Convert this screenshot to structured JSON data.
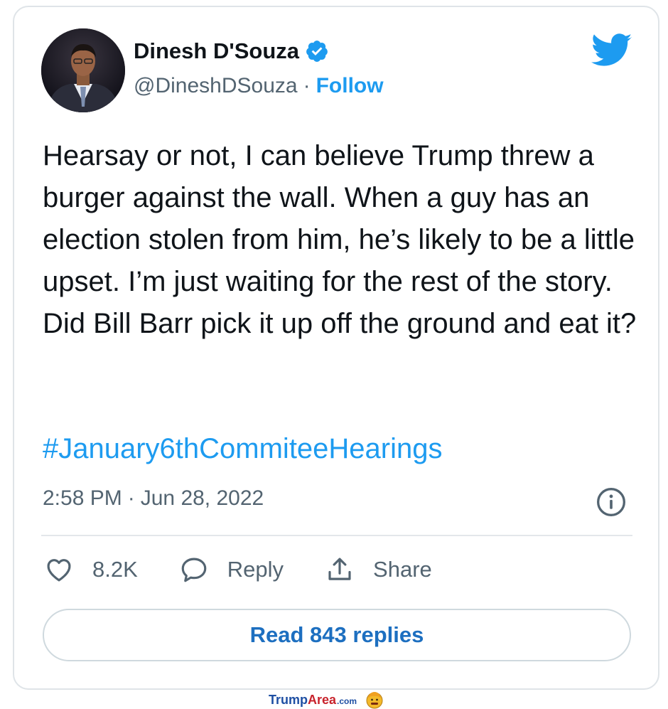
{
  "author": {
    "name": "Dinesh D'Souza",
    "handle": "@DineshDSouza",
    "separator": "·",
    "follow_label": "Follow"
  },
  "tweet": {
    "text": "Hearsay or not, I can believe Trump threw a burger against the wall. When a guy has an election stolen from him, he’s likely to be a little upset. I’m just waiting for the rest of the story. Did Bill Barr pick it up off the ground and eat it?",
    "hashtag": "#January6thCommiteeHearings",
    "time": "2:58 PM",
    "date_separator": "·",
    "date": "Jun 28, 2022"
  },
  "actions": {
    "likes": "8.2K",
    "reply_label": "Reply",
    "share_label": "Share"
  },
  "read_replies_label": "Read 843 replies",
  "watermark": {
    "part1": "Trump",
    "part2": "Area",
    "part3": ".com"
  },
  "icons": [
    "verified-icon",
    "twitter-bird-icon",
    "info-icon",
    "heart-icon",
    "reply-icon",
    "share-icon",
    "emoji-icon"
  ],
  "colors": {
    "accent": "#1d9bf0",
    "text": "#0f1419",
    "muted": "#536471",
    "border": "#cfd9de"
  }
}
